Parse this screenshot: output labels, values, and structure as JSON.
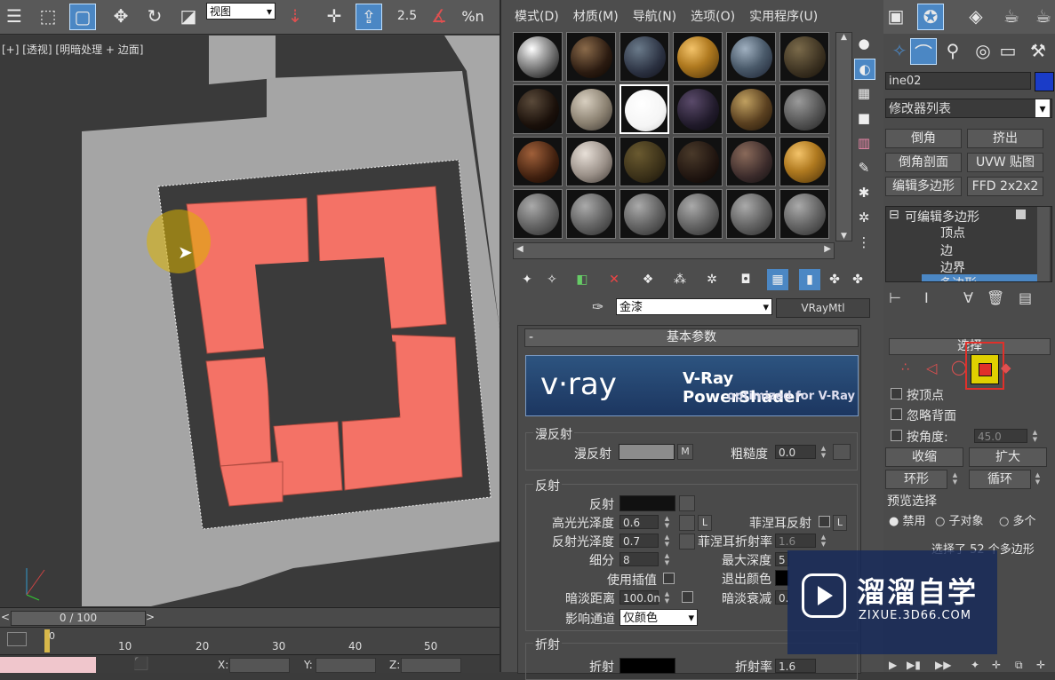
{
  "toolbar": {
    "view_select": "视图",
    "snap_25": "2.5",
    "snap_percent": "%n"
  },
  "viewport": {
    "label": "[+] [透视] [明暗处理 + 边面]"
  },
  "timeline": {
    "frame": "0 / 100",
    "ticks": [
      "0",
      "10",
      "20",
      "30",
      "40",
      "50"
    ]
  },
  "statusbar": {
    "x_label": "X:",
    "y_label": "Y:",
    "z_label": "Z:"
  },
  "material_editor": {
    "menu": [
      "模式(D)",
      "材质(M)",
      "导航(N)",
      "选项(O)",
      "实用程序(U)"
    ],
    "material_name": "金漆",
    "material_type": "VRayMtl",
    "rollout_title": "基本参数",
    "banner": {
      "brand": "v·ray",
      "product": "V-Ray PowerShader",
      "tagline": "optimized for V-Ray"
    },
    "diffuse": {
      "group": "漫反射",
      "label": "漫反射",
      "map_btn": "M",
      "roughness_label": "粗糙度",
      "roughness_value": "0.0"
    },
    "reflection": {
      "group": "反射",
      "reflect_label": "反射",
      "hilight_label": "高光光泽度",
      "hilight_value": "0.6",
      "lock_btn": "L",
      "glossy_label": "反射光泽度",
      "glossy_value": "0.7",
      "subdivs_label": "细分",
      "subdivs_value": "8",
      "interp_label": "使用插值",
      "dim_dist_label": "暗淡距离",
      "dim_dist_value": "100.0n",
      "affect_label": "影响通道",
      "affect_value": "仅颜色",
      "fresnel_label": "菲涅耳反射",
      "fresnel_lock": "L",
      "fresnel_ior_label": "菲涅耳折射率",
      "fresnel_ior_value": "1.6",
      "max_depth_label": "最大深度",
      "max_depth_value": "5",
      "exit_color_label": "退出颜色",
      "dim_falloff_label": "暗淡衰减",
      "dim_falloff_value": "0."
    },
    "refraction": {
      "group": "折射",
      "refract_label": "折射",
      "ior_label": "折射率",
      "ior_value": "1.6"
    }
  },
  "command_panel": {
    "object_name": "ine02",
    "object_color": "#1a3cc8",
    "modifier_list": "修改器列表",
    "buttons": [
      [
        "倒角",
        "挤出"
      ],
      [
        "倒角剖面",
        "UVW 贴图"
      ],
      [
        "编辑多边形",
        "FFD 2x2x2"
      ]
    ],
    "stack": {
      "root": "可编辑多边形",
      "items": [
        "顶点",
        "边",
        "边界",
        "多边形"
      ]
    },
    "selection": {
      "title": "选择",
      "by_vertex": "按顶点",
      "ignore_backface": "忽略背面",
      "by_angle": "按角度:",
      "angle_value": "45.0",
      "shrink": "收缩",
      "grow": "扩大",
      "ring": "环形",
      "loop": "循环",
      "preview_title": "预览选择",
      "preview_options": [
        "禁用",
        "子对象",
        "多个"
      ],
      "status": "选择了 52 个多边形"
    }
  },
  "watermark": {
    "title": "溜溜自学",
    "url": "ZIXUE.3D66.COM"
  }
}
